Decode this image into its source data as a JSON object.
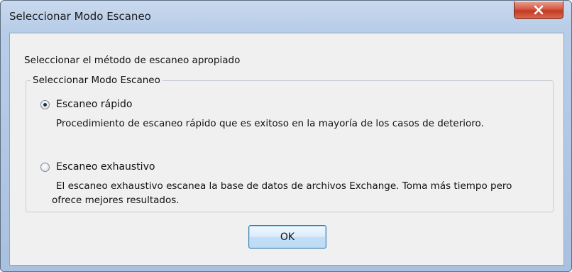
{
  "window": {
    "title": "Seleccionar Modo Escaneo"
  },
  "dialog": {
    "instruction": "Seleccionar el método de escaneo apropiado",
    "group_label": "Seleccionar Modo Escaneo",
    "options": [
      {
        "label": "Escaneo rápido",
        "checked": true,
        "description": "Procedimiento de escaneo rápido que es exitoso en la mayoría de los casos de deterioro."
      },
      {
        "label": "Escaneo exhaustivo",
        "checked": false,
        "description_line1": "El escaneo exhaustivo escanea la base de datos de archivos Exchange. Toma más tiempo pero",
        "description_line2": "ofrece mejores resultados."
      }
    ],
    "ok_label": "OK"
  },
  "icons": {
    "close": "close-icon"
  },
  "colors": {
    "close_button": "#c94a33",
    "ok_border": "#3c7fb1"
  }
}
